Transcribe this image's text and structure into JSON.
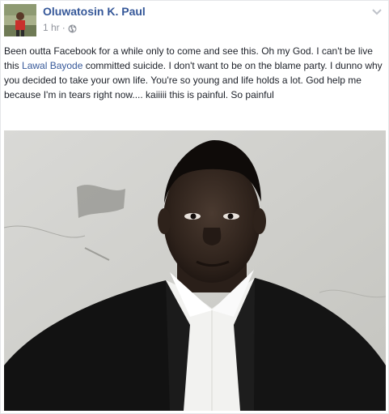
{
  "post": {
    "author": "Oluwatosin K. Paul",
    "timestamp": "1 hr",
    "separator": "·",
    "privacy_icon": "globe-icon",
    "menu_icon": "chevron-down-icon",
    "text_part1": "Been outta Facebook for a while only to come and see this. Oh my God. I can't be live this ",
    "mention": "Lawal Bayode",
    "text_part2": " committed suicide. I don't want to be on the blame party. I dunno why you decided to take your own life. You're so young and life holds a lot. God help me because I'm in tears right now.... kaiiiii this is painful. So painful"
  },
  "colors": {
    "author_link": "#365899",
    "meta_text": "#90949c",
    "body_text": "#1d2129"
  }
}
